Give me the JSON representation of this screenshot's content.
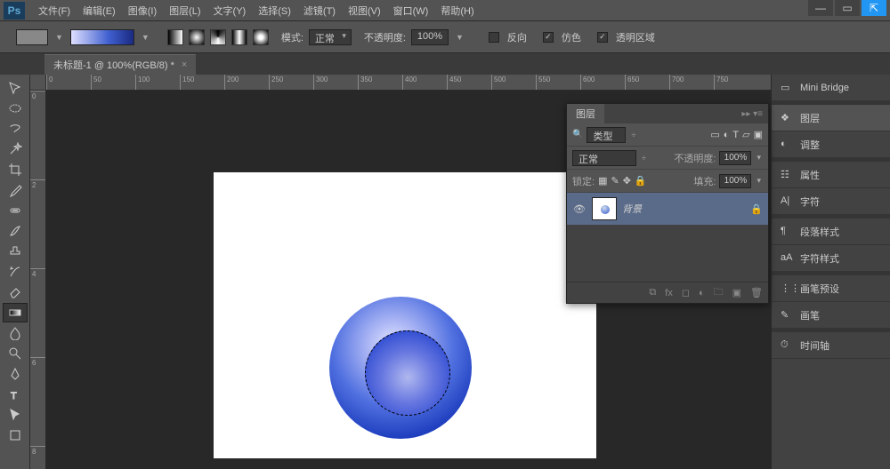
{
  "menu": {
    "items": [
      "文件(F)",
      "编辑(E)",
      "图像(I)",
      "图层(L)",
      "文字(Y)",
      "选择(S)",
      "滤镜(T)",
      "视图(V)",
      "窗口(W)",
      "帮助(H)"
    ]
  },
  "app_logo": "Ps",
  "options": {
    "mode_label": "模式:",
    "mode_value": "正常",
    "opacity_label": "不透明度:",
    "opacity_value": "100%",
    "reverse": "反向",
    "dither": "仿色",
    "transparency": "透明区域"
  },
  "doc_tab": {
    "title": "未标题-1 @ 100%(RGB/8) *",
    "close": "×"
  },
  "ruler_h": [
    0,
    50,
    100,
    150,
    200,
    250,
    300,
    350,
    400,
    450,
    500,
    550,
    600,
    650,
    700,
    750
  ],
  "ruler_v": [
    0,
    2,
    4,
    6,
    8
  ],
  "dock": {
    "items": [
      {
        "label": "Mini Bridge",
        "icon": "image"
      },
      {
        "label": "图层",
        "icon": "layers",
        "active": true
      },
      {
        "label": "调整",
        "icon": "adjust"
      },
      {
        "label": "属性",
        "icon": "props"
      },
      {
        "label": "字符",
        "icon": "char"
      },
      {
        "label": "段落样式",
        "icon": "para"
      },
      {
        "label": "字符样式",
        "icon": "charstyle"
      },
      {
        "label": "画笔预设",
        "icon": "brushpreset"
      },
      {
        "label": "画笔",
        "icon": "brush"
      },
      {
        "label": "时间轴",
        "icon": "timeline"
      }
    ]
  },
  "layers_panel": {
    "title": "图层",
    "kind_label": "类型",
    "blend": "正常",
    "opacity_label": "不透明度:",
    "opacity_value": "100%",
    "lock_label": "锁定:",
    "fill_label": "填充:",
    "fill_value": "100%",
    "layer": {
      "name": "背景"
    }
  }
}
